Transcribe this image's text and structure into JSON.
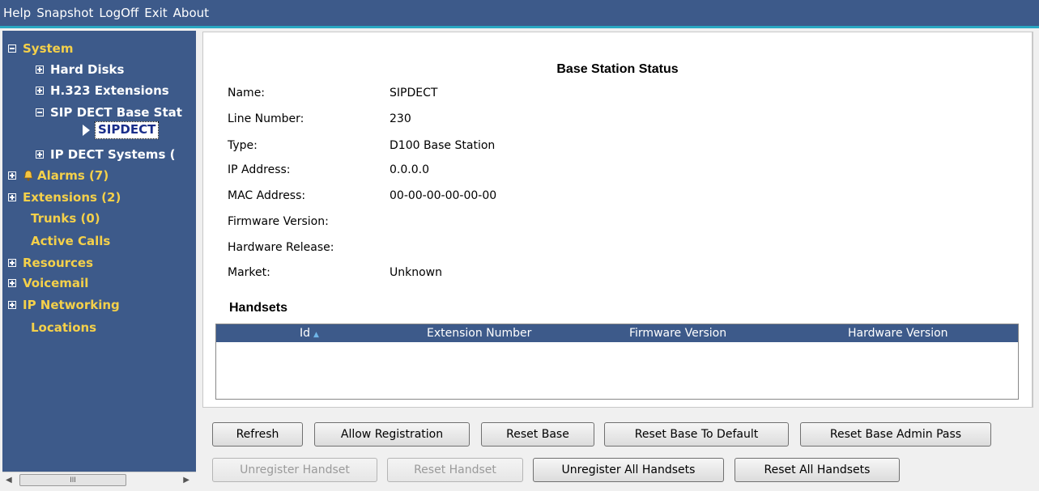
{
  "menu": {
    "help": "Help",
    "snapshot": "Snapshot",
    "logoff": "LogOff",
    "exit": "Exit",
    "about": "About"
  },
  "tree": {
    "system": "System",
    "hard_disks": "Hard Disks",
    "h323_extensions": "H.323 Extensions",
    "sip_dect_base_stations": "SIP DECT Base Stat",
    "sipdect": "SIPDECT",
    "ip_dect_systems": "IP DECT Systems (",
    "alarms": "Alarms (7)",
    "extensions": "Extensions (2)",
    "trunks": "Trunks (0)",
    "active_calls": "Active Calls",
    "resources": "Resources",
    "voicemail": "Voicemail",
    "ip_networking": "IP Networking",
    "locations": "Locations"
  },
  "scrollbar": {
    "thumb_grip": "III"
  },
  "status": {
    "title": "Base Station Status",
    "labels": {
      "name": "Name:",
      "line_number": "Line Number:",
      "type": "Type:",
      "ip_address": "IP Address:",
      "mac_address": "MAC Address:",
      "firmware_version": "Firmware Version:",
      "hardware_release": "Hardware Release:",
      "market": "Market:"
    },
    "values": {
      "name": "SIPDECT",
      "line_number": "230",
      "type": "D100 Base Station",
      "ip_address": "0.0.0.0",
      "mac_address": "00-00-00-00-00-00",
      "firmware_version": "",
      "hardware_release": "",
      "market": "Unknown"
    }
  },
  "handsets": {
    "title": "Handsets",
    "columns": {
      "id": "Id",
      "extension_number": "Extension Number",
      "firmware_version": "Firmware Version",
      "hardware_version": "Hardware Version"
    },
    "rows": []
  },
  "buttons": {
    "refresh": "Refresh",
    "allow_registration": "Allow Registration",
    "reset_base": "Reset Base",
    "reset_base_to_default": "Reset Base To Default",
    "reset_base_admin_pass": "Reset Base Admin Pass",
    "unregister_handset": "Unregister Handset",
    "reset_handset": "Reset Handset",
    "unregister_all_handsets": "Unregister All Handsets",
    "reset_all_handsets": "Reset All Handsets"
  },
  "colors": {
    "nav_background": "#3d5a8a",
    "nav_text_yellow": "#f4d04a",
    "accent_line": "#2aa8c2",
    "sort_arrow": "#6fb5e8"
  }
}
